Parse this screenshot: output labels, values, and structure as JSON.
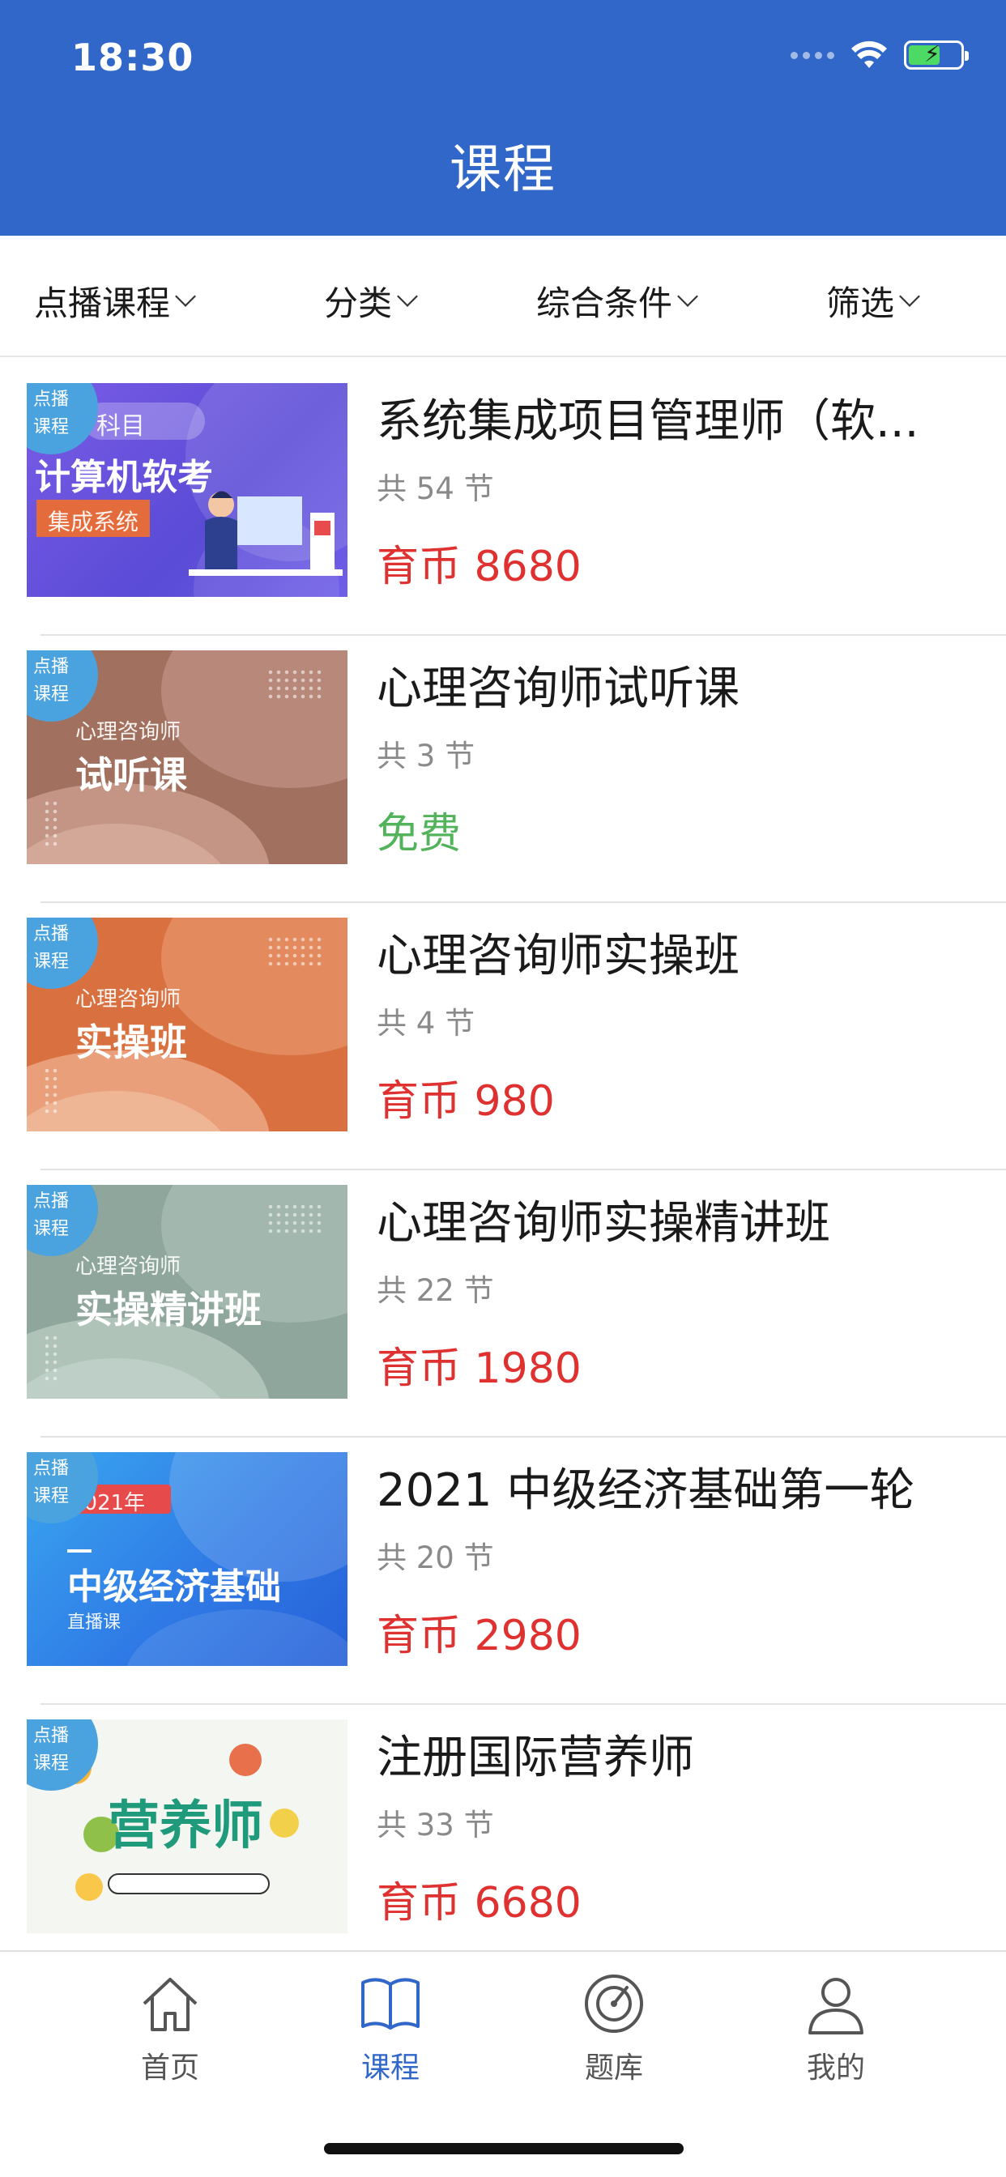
{
  "status": {
    "time": "18:30"
  },
  "header": {
    "title": "课程"
  },
  "filters": [
    {
      "label": "点播课程"
    },
    {
      "label": "分类"
    },
    {
      "label": "综合条件"
    },
    {
      "label": "筛选"
    }
  ],
  "courses": [
    {
      "badge": "点播课程",
      "thumb_sub": "科目",
      "thumb_main": "计算机软考",
      "thumb_tag": "集成系统",
      "title": "系统集成项目管理师（软...",
      "lessons": "共 54 节",
      "price": "育币 8680"
    },
    {
      "badge": "点播课程",
      "thumb_sub": "心理咨询师",
      "thumb_main": "试听课",
      "title": "心理咨询师试听课",
      "lessons": "共 3 节",
      "price": "免费"
    },
    {
      "badge": "点播课程",
      "thumb_sub": "心理咨询师",
      "thumb_main": "实操班",
      "title": "心理咨询师实操班",
      "lessons": "共 4 节",
      "price": "育币 980"
    },
    {
      "badge": "点播课程",
      "thumb_sub": "心理咨询师",
      "thumb_main": "实操精讲班",
      "title": "心理咨询师实操精讲班",
      "lessons": "共 22 节",
      "price": "育币 1980"
    },
    {
      "badge": "点播课程",
      "thumb_sub": "2021年",
      "thumb_main": "中级经济基础",
      "thumb_tag": "直播课",
      "title": "2021 中级经济基础第一轮",
      "lessons": "共 20 节",
      "price": "育币 2980"
    },
    {
      "badge": "点播课程",
      "thumb_main": "营养师",
      "title": "注册国际营养师",
      "lessons": "共 33 节",
      "price": "育币 6680"
    }
  ],
  "tabs": [
    {
      "label": "首页",
      "icon": "home-icon"
    },
    {
      "label": "课程",
      "icon": "book-icon",
      "active": true
    },
    {
      "label": "题库",
      "icon": "question-bank-icon"
    },
    {
      "label": "我的",
      "icon": "profile-icon"
    }
  ],
  "colors": {
    "brand": "#3167c8",
    "price": "#e03131",
    "free": "#52b35a"
  }
}
